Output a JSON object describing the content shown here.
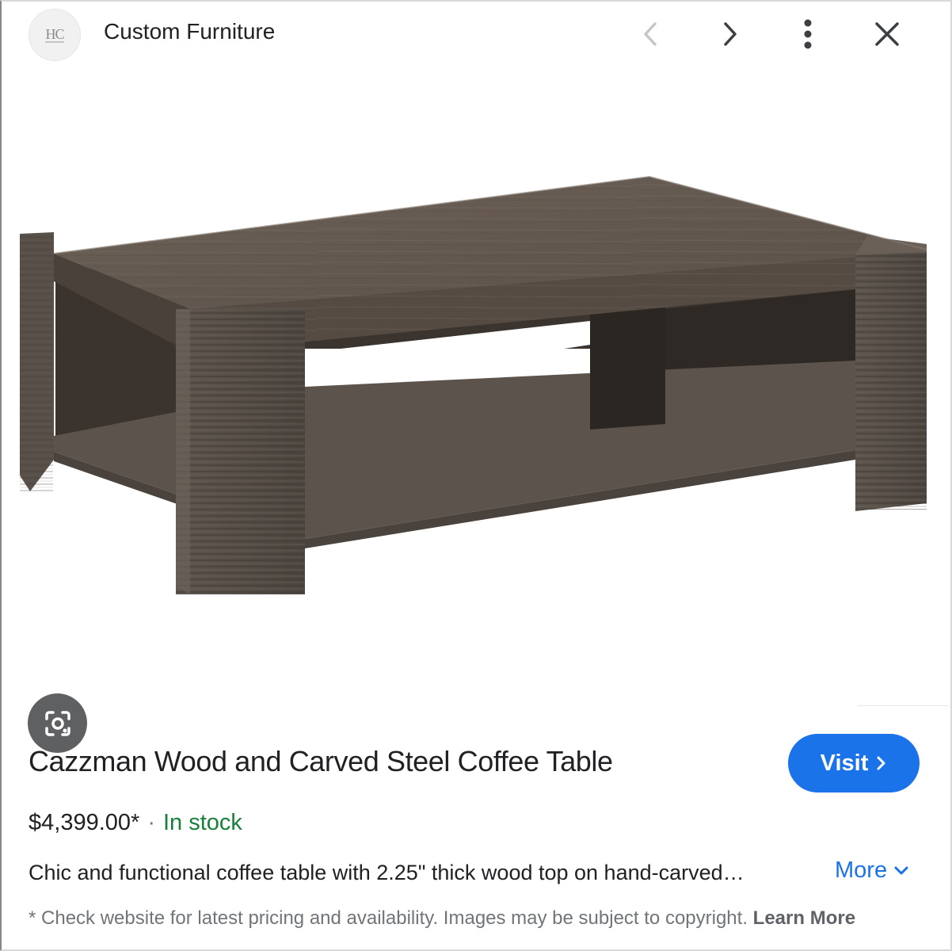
{
  "header": {
    "logo_text": "HC",
    "site_name": "Custom Furniture",
    "prev_icon": "chevron-left-icon",
    "next_icon": "chevron-right-icon",
    "more_icon": "more-vert-icon",
    "close_icon": "close-icon"
  },
  "image": {
    "subject": "coffee-table-image",
    "lens_icon": "lens-search-icon"
  },
  "product": {
    "title": "Cazzman Wood and Carved Steel Coffee Table",
    "price": "$4,399.00*",
    "separator": "·",
    "stock_status": "In stock",
    "description": "Chic and functional coffee table with 2.25\" thick wood top on hand-carved…",
    "more_label": "More",
    "visit_label": "Visit",
    "disclaimer": "* Check website for latest pricing and availability. Images may be subject to copyright.",
    "learn_more_label": "Learn More"
  },
  "colors": {
    "accent": "#1a73e8",
    "in_stock": "#188038",
    "lens_button": "#5f6061",
    "wood": "#5a5048"
  }
}
